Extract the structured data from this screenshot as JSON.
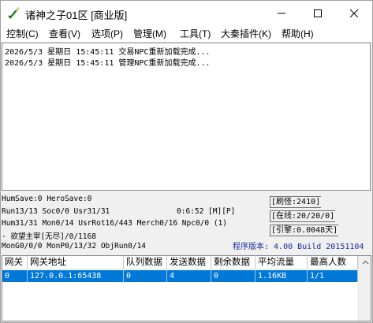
{
  "window": {
    "title": "诸神之子01区 [商业版]",
    "icon": "app-sword-icon",
    "controls": [
      "minimize-icon",
      "maximize-icon",
      "close-icon"
    ]
  },
  "menu": [
    {
      "label": "控制(C)"
    },
    {
      "label": "查看(V)"
    },
    {
      "label": "选项(P)"
    },
    {
      "label": "管理(M)"
    },
    {
      "label": "工具(T)"
    },
    {
      "label": "大秦插件(K)"
    },
    {
      "label": "帮助(H)"
    }
  ],
  "log": [
    "2026/5/3 星期日 15:45:11 交易NPC重新加载完成...",
    "2026/5/3 星期日 15:45:11 管理NPC重新加载完成..."
  ],
  "status": {
    "line1": "HumSave:0 HeroSave:0",
    "line2": "Run13/13 Soc0/0 Usr31/31",
    "time": "0:6:52 [M][P]",
    "line3": "Hum31/31 Mon0/14 UsrRot16/443 Merch0/16 Npc0/0 (1)",
    "line4": " - 欲望主宰[无尽]/0/1168",
    "line5": "MonG0/0/0 MonP0/13/32 ObjRun0/14",
    "refresh": "[刷怪:2410]",
    "online": "[在线:20/20/0]",
    "engine": "[引擎:0.0048天]",
    "version": "程序版本: 4.00 Build 20151104"
  },
  "gateway_table": {
    "columns": [
      "网关",
      "网关地址",
      "队列数据",
      "发送数据",
      "剩余数据",
      "平均流量",
      "最高人数"
    ],
    "rows": [
      [
        "0",
        "127.0.0.1:65438",
        "0",
        "4",
        "0",
        "1.16KB",
        "1/1"
      ]
    ]
  },
  "colors": {
    "selection": "#0078d7",
    "version_text": "#1a2a9c"
  }
}
